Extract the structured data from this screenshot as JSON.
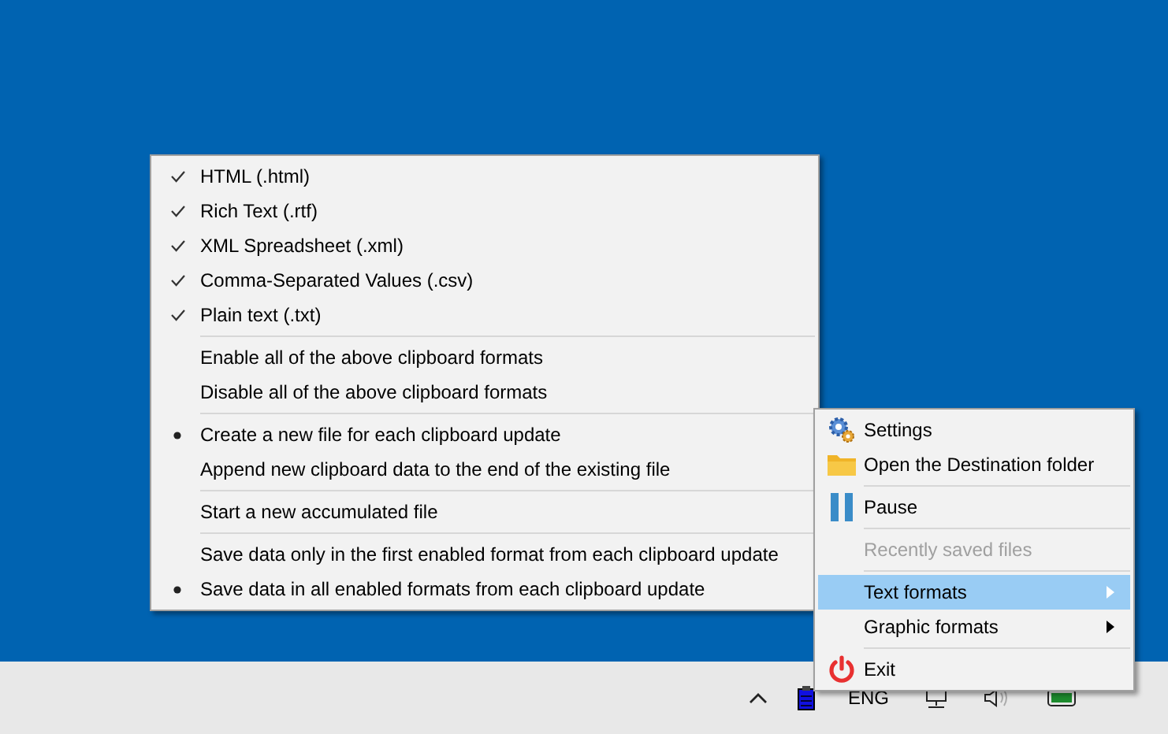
{
  "format_menu": {
    "sections": [
      {
        "items": [
          {
            "label": "HTML (.html)",
            "kind": "check",
            "checked": true
          },
          {
            "label": "Rich Text (.rtf)",
            "kind": "check",
            "checked": true
          },
          {
            "label": "XML Spreadsheet (.xml)",
            "kind": "check",
            "checked": true
          },
          {
            "label": "Comma-Separated Values (.csv)",
            "kind": "check",
            "checked": true
          },
          {
            "label": "Plain text (.txt)",
            "kind": "check",
            "checked": true
          }
        ]
      },
      {
        "items": [
          {
            "label": "Enable all of the above clipboard formats",
            "kind": "plain"
          },
          {
            "label": "Disable all of the above clipboard formats",
            "kind": "plain"
          }
        ]
      },
      {
        "items": [
          {
            "label": "Create a new file for each clipboard update",
            "kind": "radio",
            "checked": true
          },
          {
            "label": "Append new clipboard data to the end of the existing file",
            "kind": "radio",
            "checked": false
          }
        ]
      },
      {
        "items": [
          {
            "label": "Start a new accumulated file",
            "kind": "plain"
          }
        ]
      },
      {
        "items": [
          {
            "label": "Save data only in the first enabled format from each clipboard update",
            "kind": "radio",
            "checked": false
          },
          {
            "label": "Save data in all enabled formats from each clipboard update",
            "kind": "radio",
            "checked": true
          }
        ]
      }
    ]
  },
  "tray_menu": {
    "sections": [
      {
        "items": [
          {
            "label": "Settings",
            "kind": "gear",
            "selected": false,
            "disabled": false,
            "submenu": false
          },
          {
            "label": "Open the Destination folder",
            "kind": "folder",
            "selected": false,
            "disabled": false,
            "submenu": false
          }
        ]
      },
      {
        "items": [
          {
            "label": "Pause",
            "kind": "pause",
            "selected": false,
            "disabled": false,
            "submenu": false
          }
        ]
      },
      {
        "items": [
          {
            "label": "Recently saved files",
            "selected": false,
            "disabled": true,
            "submenu": false
          }
        ]
      },
      {
        "items": [
          {
            "label": "Text formats",
            "selected": true,
            "disabled": false,
            "submenu": true
          },
          {
            "label": "Graphic formats",
            "selected": false,
            "disabled": false,
            "submenu": true
          }
        ]
      },
      {
        "items": [
          {
            "label": "Exit",
            "kind": "power",
            "selected": false,
            "disabled": false,
            "submenu": false
          }
        ]
      }
    ]
  },
  "taskbar": {
    "language": "ENG"
  }
}
